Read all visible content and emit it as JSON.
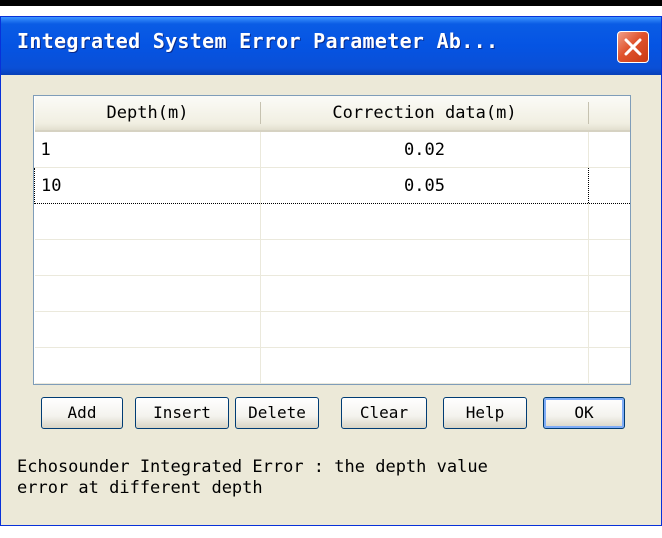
{
  "dialog": {
    "title": "Integrated System Error Parameter Ab...",
    "close_icon": "close-icon"
  },
  "table": {
    "columns": [
      "Depth(m)",
      "Correction data(m)"
    ],
    "rows": [
      {
        "depth": "1",
        "correction": "0.02"
      },
      {
        "depth": "10",
        "correction": "0.05"
      }
    ]
  },
  "buttons": {
    "add": "Add",
    "insert": "Insert",
    "delete": "Delete",
    "clear": "Clear",
    "help": "Help",
    "ok": "OK"
  },
  "status": {
    "text": "Echosounder Integrated Error : the depth value\nerror at different depth"
  },
  "colors": {
    "titlebar": "#0554e3",
    "window": "#ece9d8",
    "close_button": "#e0532d"
  }
}
